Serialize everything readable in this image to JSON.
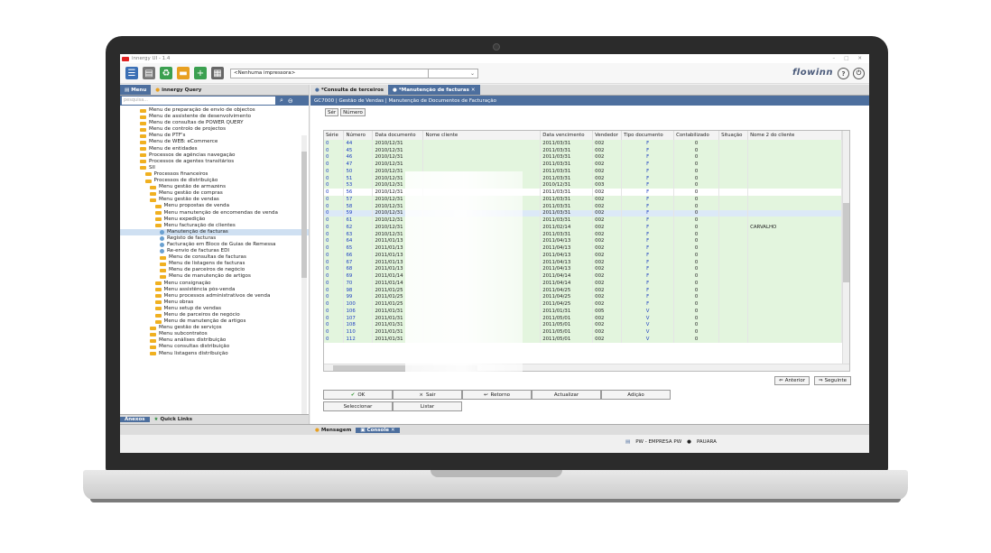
{
  "window_title": "innergy UI - 1.4",
  "toolbar": {
    "printer": "<Nenhuma impressora>",
    "brand": "flowinn"
  },
  "left_panel": {
    "tab_menu": "Menu",
    "tab_query": "innergy Query",
    "search_placeholder": "pesquisa...",
    "tree": [
      {
        "label": "Menu de preparação de envio de objectos",
        "level": 2,
        "icon": "folder"
      },
      {
        "label": "Menu de assistente de desenvolvimento",
        "level": 2,
        "icon": "folder"
      },
      {
        "label": "Menu de consultas de POWER QUERY",
        "level": 2,
        "icon": "folder"
      },
      {
        "label": "Menu de controlo de projectos",
        "level": 2,
        "icon": "folder"
      },
      {
        "label": "Menu de PTF's",
        "level": 2,
        "icon": "folder"
      },
      {
        "label": "Menu de WEB: eCommerce",
        "level": 2,
        "icon": "folder"
      },
      {
        "label": "Menu de entidades",
        "level": 2,
        "icon": "folder"
      },
      {
        "label": "Processos de agências navegação",
        "level": 2,
        "icon": "folder"
      },
      {
        "label": "Processos de agentes transitários",
        "level": 2,
        "icon": "folder"
      },
      {
        "label": "SII",
        "level": 2,
        "icon": "folder"
      },
      {
        "label": "Processos financeiros",
        "level": 3,
        "icon": "folder"
      },
      {
        "label": "Processos de distribuição",
        "level": 3,
        "icon": "folder"
      },
      {
        "label": "Menu gestão de armazéns",
        "level": 4,
        "icon": "folder"
      },
      {
        "label": "Menu gestão de compras",
        "level": 4,
        "icon": "folder"
      },
      {
        "label": "Menu gestão de vendas",
        "level": 4,
        "icon": "folder"
      },
      {
        "label": "Menu propostas de venda",
        "level": 5,
        "icon": "folder"
      },
      {
        "label": "Menu manutenção de encomendas de venda",
        "level": 5,
        "icon": "folder"
      },
      {
        "label": "Menu expedição",
        "level": 5,
        "icon": "folder"
      },
      {
        "label": "Menu facturação de clientes",
        "level": 5,
        "icon": "folder"
      },
      {
        "label": "Manutenção de facturas",
        "level": 6,
        "icon": "gear",
        "selected": true
      },
      {
        "label": "Registo de facturas",
        "level": 6,
        "icon": "gear"
      },
      {
        "label": "Facturação em Bloco de Guias de Remessa",
        "level": 6,
        "icon": "gear"
      },
      {
        "label": "Re-envio de facturas EDI",
        "level": 6,
        "icon": "gear"
      },
      {
        "label": "Menu de consultas de facturas",
        "level": 6,
        "icon": "folder"
      },
      {
        "label": "Menu de listagens de facturas",
        "level": 6,
        "icon": "folder"
      },
      {
        "label": "Menu de parceiros de negócio",
        "level": 6,
        "icon": "folder"
      },
      {
        "label": "Menu de manutenção de artigos",
        "level": 6,
        "icon": "folder"
      },
      {
        "label": "Menu consignação",
        "level": 5,
        "icon": "folder"
      },
      {
        "label": "Menu assistência pós-venda",
        "level": 5,
        "icon": "folder"
      },
      {
        "label": "Menu processos administrativos de venda",
        "level": 5,
        "icon": "folder"
      },
      {
        "label": "Menu obras",
        "level": 5,
        "icon": "folder"
      },
      {
        "label": "Menu setup de vendas",
        "level": 5,
        "icon": "folder"
      },
      {
        "label": "Menu de parceiros de negócio",
        "level": 5,
        "icon": "folder"
      },
      {
        "label": "Menu de manutenção de artigos",
        "level": 5,
        "icon": "folder"
      },
      {
        "label": "Menu gestão de serviços",
        "level": 4,
        "icon": "folder"
      },
      {
        "label": "Menu subcontratos",
        "level": 4,
        "icon": "folder"
      },
      {
        "label": "Menu análises distribuição",
        "level": 4,
        "icon": "folder"
      },
      {
        "label": "Menu consultas distribuição",
        "level": 4,
        "icon": "folder"
      },
      {
        "label": "Menu listagens distribuição",
        "level": 4,
        "icon": "folder"
      }
    ],
    "bottom_tab_anexos": "Anexos",
    "bottom_tab_quicklinks": "Quick Links"
  },
  "doc_tabs": [
    "*Consulta de terceiros",
    "*Manutenção de facturas"
  ],
  "breadcrumb": "GC7000 | Gestão de Vendas | Manutenção de Documentos de Facturação",
  "filter": {
    "label1": "Sér",
    "label2": "Número"
  },
  "grid": {
    "headers": [
      "Série",
      "Número",
      "Data documento",
      "Nome cliente",
      "Data vencimento",
      "Vendedor",
      "Tipo documento",
      "Contabilizado",
      "Situação",
      "Nome 2 do cliente"
    ],
    "rows": [
      [
        "0",
        "44",
        "2010/12/31",
        "",
        "2011/03/31",
        "002",
        "F",
        "0",
        "",
        ""
      ],
      [
        "0",
        "45",
        "2010/12/31",
        "",
        "2011/03/31",
        "002",
        "F",
        "0",
        "",
        ""
      ],
      [
        "0",
        "46",
        "2010/12/31",
        "",
        "2011/03/31",
        "002",
        "F",
        "0",
        "",
        ""
      ],
      [
        "0",
        "47",
        "2010/12/31",
        "",
        "2011/03/31",
        "002",
        "F",
        "0",
        "",
        ""
      ],
      [
        "0",
        "50",
        "2010/12/31",
        "",
        "2011/03/31",
        "002",
        "F",
        "0",
        "",
        ""
      ],
      [
        "0",
        "51",
        "2010/12/31",
        "",
        "2011/03/31",
        "002",
        "F",
        "0",
        "",
        ""
      ],
      [
        "0",
        "53",
        "2010/12/31",
        "",
        "2010/12/31",
        "003",
        "F",
        "0",
        "",
        ""
      ],
      [
        "0",
        "56",
        "2010/12/31",
        "",
        "2011/03/31",
        "002",
        "F",
        "0",
        "",
        ""
      ],
      [
        "0",
        "57",
        "2010/12/31",
        "",
        "2011/03/31",
        "002",
        "F",
        "0",
        "",
        ""
      ],
      [
        "0",
        "58",
        "2010/12/31",
        "",
        "2011/03/31",
        "002",
        "F",
        "0",
        "",
        ""
      ],
      [
        "0",
        "59",
        "2010/12/31",
        "",
        "2011/03/31",
        "002",
        "F",
        "0",
        "",
        ""
      ],
      [
        "0",
        "61",
        "2010/12/31",
        "",
        "2011/03/31",
        "002",
        "F",
        "0",
        "",
        ""
      ],
      [
        "0",
        "62",
        "2010/12/31",
        "",
        "2011/02/14",
        "002",
        "F",
        "0",
        "",
        "CARVALHO"
      ],
      [
        "0",
        "63",
        "2010/12/31",
        "",
        "2011/03/31",
        "002",
        "F",
        "0",
        "",
        ""
      ],
      [
        "0",
        "64",
        "2011/01/13",
        "",
        "2011/04/13",
        "002",
        "F",
        "0",
        "",
        ""
      ],
      [
        "0",
        "65",
        "2011/01/13",
        "",
        "2011/04/13",
        "002",
        "F",
        "0",
        "",
        ""
      ],
      [
        "0",
        "66",
        "2011/01/13",
        "",
        "2011/04/13",
        "002",
        "F",
        "0",
        "",
        ""
      ],
      [
        "0",
        "67",
        "2011/01/13",
        "",
        "2011/04/13",
        "002",
        "F",
        "0",
        "",
        ""
      ],
      [
        "0",
        "68",
        "2011/01/13",
        "",
        "2011/04/13",
        "002",
        "F",
        "0",
        "",
        ""
      ],
      [
        "0",
        "69",
        "2011/01/14",
        "",
        "2011/04/14",
        "002",
        "F",
        "0",
        "",
        ""
      ],
      [
        "0",
        "70",
        "2011/01/14",
        "",
        "2011/04/14",
        "002",
        "F",
        "0",
        "",
        ""
      ],
      [
        "0",
        "98",
        "2011/01/25",
        "",
        "2011/04/25",
        "002",
        "F",
        "0",
        "",
        ""
      ],
      [
        "0",
        "99",
        "2011/01/25",
        "",
        "2011/04/25",
        "002",
        "F",
        "0",
        "",
        ""
      ],
      [
        "0",
        "100",
        "2011/01/25",
        "",
        "2011/04/25",
        "002",
        "F",
        "0",
        "",
        ""
      ],
      [
        "0",
        "106",
        "2011/01/31",
        "",
        "2011/01/31",
        "005",
        "V",
        "0",
        "",
        ""
      ],
      [
        "0",
        "107",
        "2011/01/31",
        "",
        "2011/05/01",
        "002",
        "V",
        "0",
        "",
        ""
      ],
      [
        "0",
        "108",
        "2011/01/31",
        "",
        "2011/05/01",
        "002",
        "V",
        "0",
        "",
        ""
      ],
      [
        "0",
        "110",
        "2011/01/31",
        "",
        "2011/05/01",
        "002",
        "V",
        "0",
        "",
        ""
      ],
      [
        "0",
        "112",
        "2011/01/31",
        "",
        "2011/05/01",
        "002",
        "V",
        "0",
        "",
        ""
      ]
    ],
    "row_styles": [
      "g",
      "g",
      "g",
      "g",
      "g",
      "g",
      "g",
      "w",
      "g",
      "g",
      "hl",
      "g",
      "g",
      "g",
      "g",
      "g",
      "g",
      "g",
      "g",
      "g",
      "g",
      "g",
      "g",
      "g",
      "g",
      "g",
      "g",
      "g",
      "g"
    ]
  },
  "nav": {
    "prev": "Anterior",
    "next": "Seguinte"
  },
  "actions": {
    "ok": "OK",
    "sair": "Sair",
    "retorno": "Retorno",
    "actualizar": "Actualizar",
    "adicao": "Adição",
    "seleccionar": "Seleccionar",
    "listar": "Listar"
  },
  "footer": {
    "mensagem": "Mensagem",
    "console": "Console"
  },
  "status": {
    "company": "PW - EMPRESA PW",
    "user": "PAUARA"
  },
  "colors": {
    "accent": "#4d6f9e",
    "row_green": "#e3f5de",
    "link_blue": "#2040c0"
  }
}
